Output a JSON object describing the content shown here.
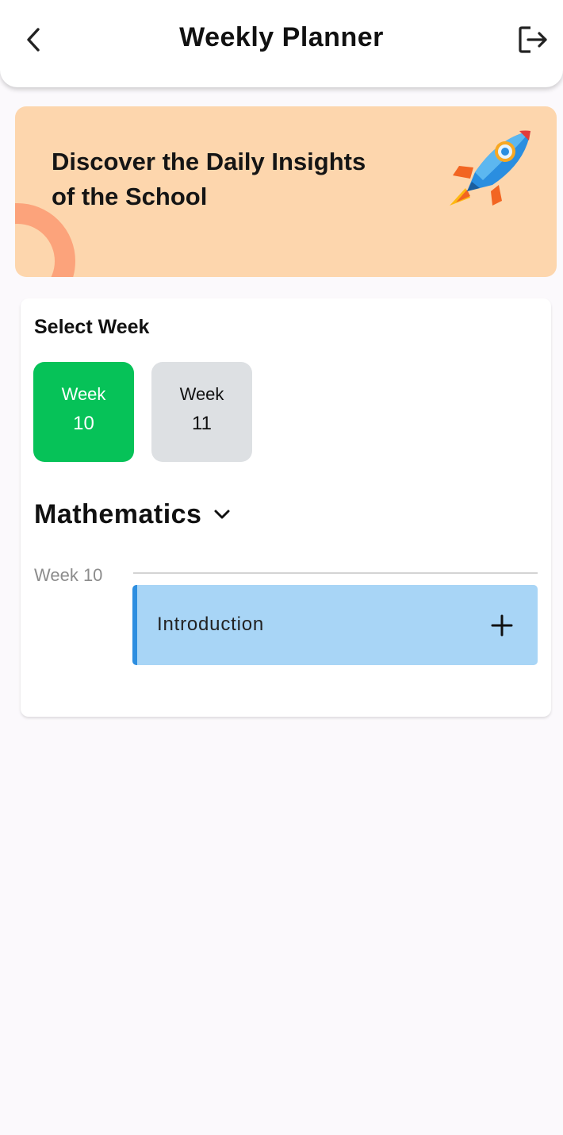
{
  "header": {
    "title": "Weekly Planner",
    "back_icon": "chevron-left-icon",
    "logout_icon": "logout-icon"
  },
  "banner": {
    "text_line1": "Discover the Daily Insights",
    "text_line2": "of the School",
    "background_color": "#fdd6ad",
    "illustration": "rocket-icon"
  },
  "week_selector": {
    "heading": "Select Week",
    "weeks": [
      {
        "label": "Week",
        "number": "10",
        "selected": true
      },
      {
        "label": "Week",
        "number": "11",
        "selected": false
      }
    ],
    "selected_color": "#06c258",
    "idle_color": "#dde0e3"
  },
  "subject": {
    "name": "Mathematics",
    "dropdown_icon": "chevron-down-icon"
  },
  "schedule": {
    "week_label": "Week 10",
    "topics": [
      {
        "title": "Introduction",
        "action_icon": "plus-icon"
      }
    ],
    "topic_color": "#a8d5f6",
    "topic_accent": "#2d8ee0"
  }
}
